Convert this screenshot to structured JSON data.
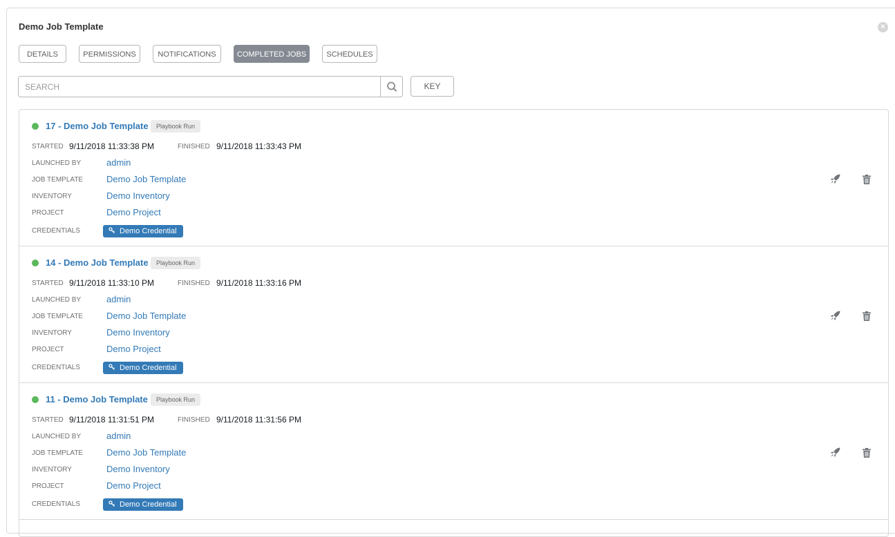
{
  "header": {
    "title": "Demo Job Template",
    "close_glyph": "×"
  },
  "tabs": [
    {
      "label": "DETAILS",
      "active": false
    },
    {
      "label": "PERMISSIONS",
      "active": false
    },
    {
      "label": "NOTIFICATIONS",
      "active": false
    },
    {
      "label": "COMPLETED JOBS",
      "active": true
    },
    {
      "label": "SCHEDULES",
      "active": false
    }
  ],
  "search": {
    "placeholder": "SEARCH",
    "value": "",
    "icon": "search-icon"
  },
  "key_button": {
    "label": "KEY"
  },
  "field_labels": {
    "started": "STARTED",
    "finished": "FINISHED",
    "launched_by": "LAUNCHED BY",
    "job_template": "JOB TEMPLATE",
    "inventory": "INVENTORY",
    "project": "PROJECT",
    "credentials": "CREDENTIALS"
  },
  "colors": {
    "status_success": "#5cb85c",
    "link": "#337ab7",
    "active_tab": "#848992"
  },
  "jobs": [
    {
      "name": "17 - Demo Job Template",
      "type": "Playbook Run",
      "status": "successful",
      "started": "9/11/2018 11:33:38 PM",
      "finished": "9/11/2018 11:33:43 PM",
      "launched_by": "admin",
      "job_template": "Demo Job Template",
      "inventory": "Demo Inventory",
      "project": "Demo Project",
      "credential": "Demo Credential"
    },
    {
      "name": "14 - Demo Job Template",
      "type": "Playbook Run",
      "status": "successful",
      "started": "9/11/2018 11:33:10 PM",
      "finished": "9/11/2018 11:33:16 PM",
      "launched_by": "admin",
      "job_template": "Demo Job Template",
      "inventory": "Demo Inventory",
      "project": "Demo Project",
      "credential": "Demo Credential"
    },
    {
      "name": "11 - Demo Job Template",
      "type": "Playbook Run",
      "status": "successful",
      "started": "9/11/2018 11:31:51 PM",
      "finished": "9/11/2018 11:31:56 PM",
      "launched_by": "admin",
      "job_template": "Demo Job Template",
      "inventory": "Demo Inventory",
      "project": "Demo Project",
      "credential": "Demo Credential"
    }
  ],
  "row_actions": {
    "relaunch_icon": "rocket-icon",
    "delete_icon": "trash-icon"
  }
}
